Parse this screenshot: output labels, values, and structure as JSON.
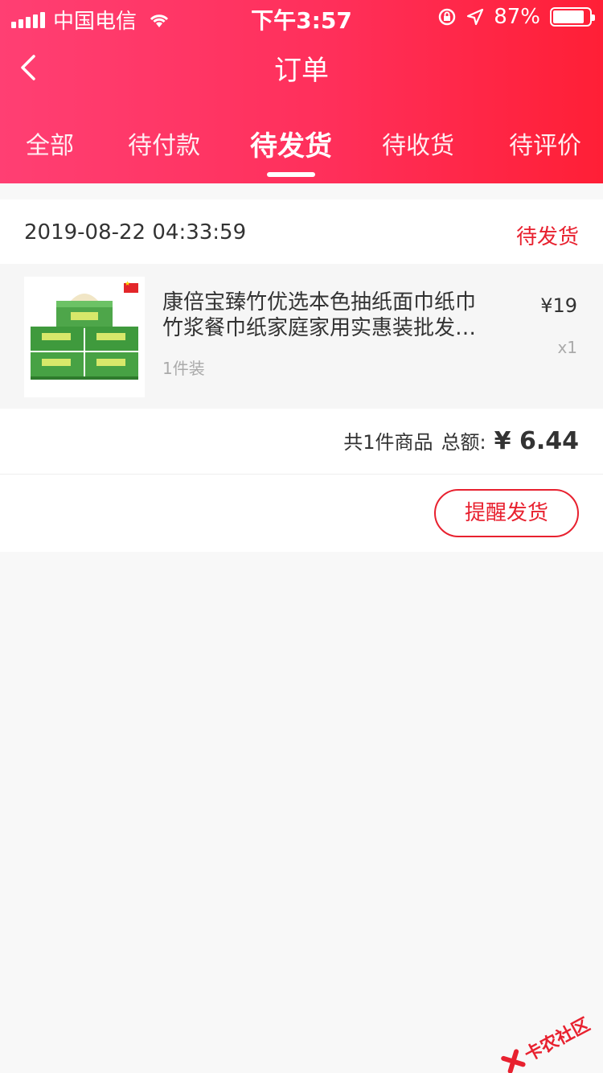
{
  "status_bar": {
    "carrier": "中国电信",
    "time": "下午3:57",
    "battery": "87%",
    "battery_level": 0.87
  },
  "nav": {
    "title": "订单",
    "back_icon": "chevron-left-icon"
  },
  "tabs": [
    {
      "label": "全部",
      "active": false
    },
    {
      "label": "待付款",
      "active": false
    },
    {
      "label": "待发货",
      "active": true
    },
    {
      "label": "待收货",
      "active": false
    },
    {
      "label": "待评价",
      "active": false
    }
  ],
  "order": {
    "time": "2019-08-22 04:33:59",
    "status": "待发货",
    "product": {
      "name": "康倍宝臻竹优选本色抽纸面巾纸巾竹浆餐巾纸家庭家用实惠装批发…",
      "spec": "1件装",
      "price": "¥19",
      "qty": "x1"
    },
    "summary": {
      "count_label": "共1件商品",
      "total_label": "总额:",
      "total": "¥ 6.44"
    },
    "remind_button": "提醒发货"
  },
  "watermark": "卡农社区",
  "colors": {
    "accent": "#e8212f",
    "header_start": "#ff3f73",
    "header_end": "#ff1f36"
  }
}
